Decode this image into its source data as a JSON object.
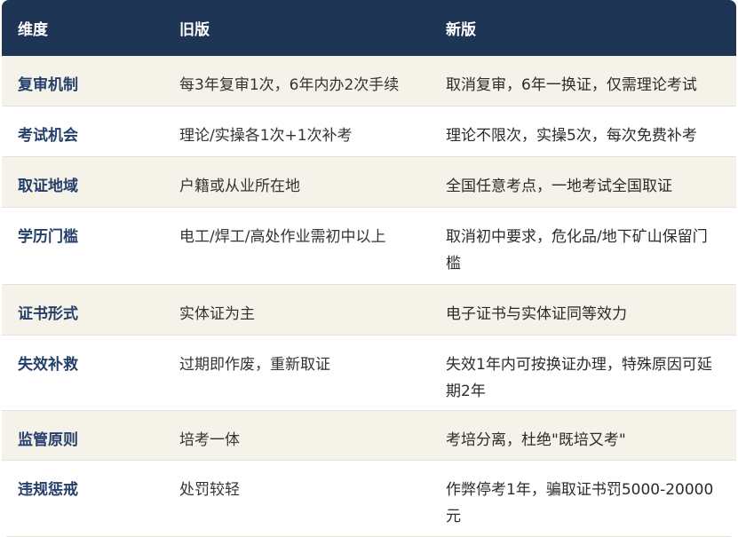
{
  "table": {
    "headers": [
      "维度",
      "旧版",
      "新版"
    ],
    "rows": [
      {
        "dimension": "复审机制",
        "old": "每3年复审1次，6年内办2次手续",
        "new": "取消复审，6年一换证，仅需理论考试"
      },
      {
        "dimension": "考试机会",
        "old": "理论/实操各1次+1次补考",
        "new": "理论不限次，实操5次，每次免费补考"
      },
      {
        "dimension": "取证地域",
        "old": "户籍或从业所在地",
        "new": "全国任意考点，一地考试全国取证"
      },
      {
        "dimension": "学历门槛",
        "old": "电工/焊工/高处作业需初中以上",
        "new": "取消初中要求，危化品/地下矿山保留门槛"
      },
      {
        "dimension": "证书形式",
        "old": "实体证为主",
        "new": "电子证书与实体证同等效力"
      },
      {
        "dimension": "失效补救",
        "old": "过期即作废，重新取证",
        "new": "失效1年内可按换证办理，特殊原因可延期2年"
      },
      {
        "dimension": "监管原则",
        "old": "培考一体",
        "new": "考培分离，杜绝\"既培又考\""
      },
      {
        "dimension": "违规惩戒",
        "old": "处罚较轻",
        "new": "作弊停考1年，骗取证书罚5000-20000元"
      }
    ]
  }
}
